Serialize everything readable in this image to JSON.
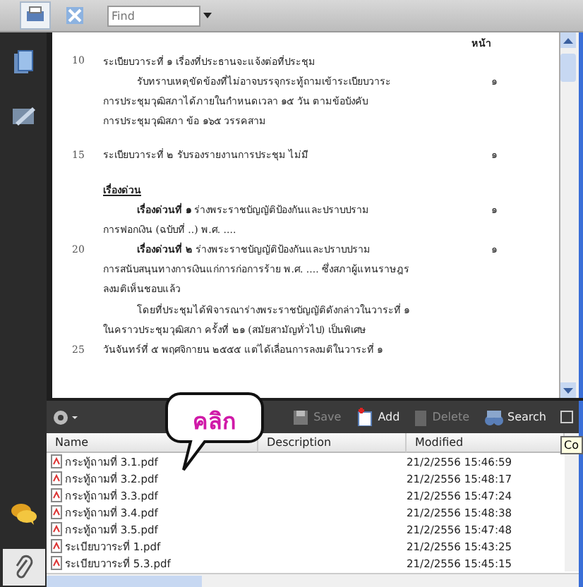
{
  "toolbar": {
    "find": {
      "placeholder": "Find"
    }
  },
  "sidebar": {
    "top": [
      {
        "kind": "pages",
        "selected": false
      },
      {
        "kind": "signatures",
        "selected": false
      }
    ],
    "bottom": [
      {
        "kind": "comments",
        "selected": false
      },
      {
        "kind": "attachments",
        "selected": true
      }
    ]
  },
  "document": {
    "page_header": "หน้า",
    "lines": [
      {
        "line_no": "10",
        "text": "ระเบียบวาระที่ ๑ เรื่องที่ประธานจะแจ้งต่อที่ประชุม",
        "indent": false,
        "underline": false
      },
      {
        "text": "รับทราบเหตุขัดข้องที่ไม่อาจบรรจุกระทู้ถามเข้าระเบียบวาระ",
        "indent": true,
        "underline": false,
        "page": "๑"
      },
      {
        "text": "การประชุมวุฒิสภาได้ภายในกำหนดเวลา ๑๕ วัน ตามข้อบังคับ",
        "indent": false,
        "underline": false
      },
      {
        "text": "การประชุมวุฒิสภา ข้อ ๑๖๕ วรรคสาม",
        "indent": false,
        "underline": false
      },
      {
        "kind": "gap"
      },
      {
        "line_no": "15",
        "text": "ระเบียบวาระที่ ๒ รับรองรายงานการประชุม ไม่มี",
        "indent": false,
        "underline": false,
        "page": "๑"
      },
      {
        "kind": "gap"
      },
      {
        "text": "เรื่องด่วน",
        "indent": false,
        "underline": true
      },
      {
        "text": "**เรื่องด่วนที่ ๑** ร่างพระราชบัญญัติป้องกันและปราบปราม",
        "indent": true,
        "underline": false,
        "page": "๑"
      },
      {
        "text": "การฟอกเงิน (ฉบับที่ ..) พ.ศ. ....",
        "indent": false,
        "underline": false
      },
      {
        "line_no": "20",
        "text": "**เรื่องด่วนที่ ๒** ร่างพระราชบัญญัติป้องกันและปราบปราม",
        "indent": true,
        "underline": false,
        "page": "๑"
      },
      {
        "text": "การสนับสนุนทางการเงินแก่การก่อการร้าย พ.ศ. .... ซึ่งสภาผู้แทนราษฎร",
        "indent": false,
        "underline": false
      },
      {
        "text": "ลงมติเห็นชอบแล้ว",
        "indent": false,
        "underline": false
      },
      {
        "text": "โดยที่ประชุมได้พิจารณาร่างพระราชบัญญัติดังกล่าวในวาระที่ ๑",
        "indent": true,
        "underline": false
      },
      {
        "text": "ในคราวประชุมวุฒิสภา ครั้งที่ ๒๑ (สมัยสามัญทั่วไป) เป็นพิเศษ",
        "indent": false,
        "underline": false
      },
      {
        "line_no": "25",
        "text": "วันจันทร์ที่ ๕ พฤศจิกายน ๒๕๕๕ แต่ได้เลื่อนการลงมติในวาระที่ ๑",
        "indent": false,
        "underline": false
      }
    ]
  },
  "attachments": {
    "actions": [
      {
        "label": "Save",
        "disabled": true,
        "kind": "save"
      },
      {
        "label": "Add",
        "disabled": false,
        "kind": "add"
      },
      {
        "label": "Delete",
        "disabled": true,
        "kind": "delete"
      },
      {
        "label": "Search",
        "disabled": false,
        "kind": "search"
      }
    ],
    "columns": [
      "Name",
      "Description",
      "Modified"
    ],
    "rows": [
      {
        "name": "กระทู้ถามที่ 3.1.pdf",
        "modified": "21/2/2556 15:46:59"
      },
      {
        "name": "กระทู้ถามที่ 3.2.pdf",
        "modified": "21/2/2556 15:48:17"
      },
      {
        "name": "กระทู้ถามที่ 3.3.pdf",
        "modified": "21/2/2556 15:47:24"
      },
      {
        "name": "กระทู้ถามที่ 3.4.pdf",
        "modified": "21/2/2556 15:48:38"
      },
      {
        "name": "กระทู้ถามที่ 3.5.pdf",
        "modified": "21/2/2556 15:47:48"
      },
      {
        "name": "ระเบียบวาระที่ 1.pdf",
        "modified": "21/2/2556 15:43:25"
      },
      {
        "name": "ระเบียบวาระที่ 5.3.pdf",
        "modified": "21/2/2556 15:45:15"
      }
    ],
    "tooltip": "Co"
  },
  "callout": {
    "text": "คลิก"
  }
}
